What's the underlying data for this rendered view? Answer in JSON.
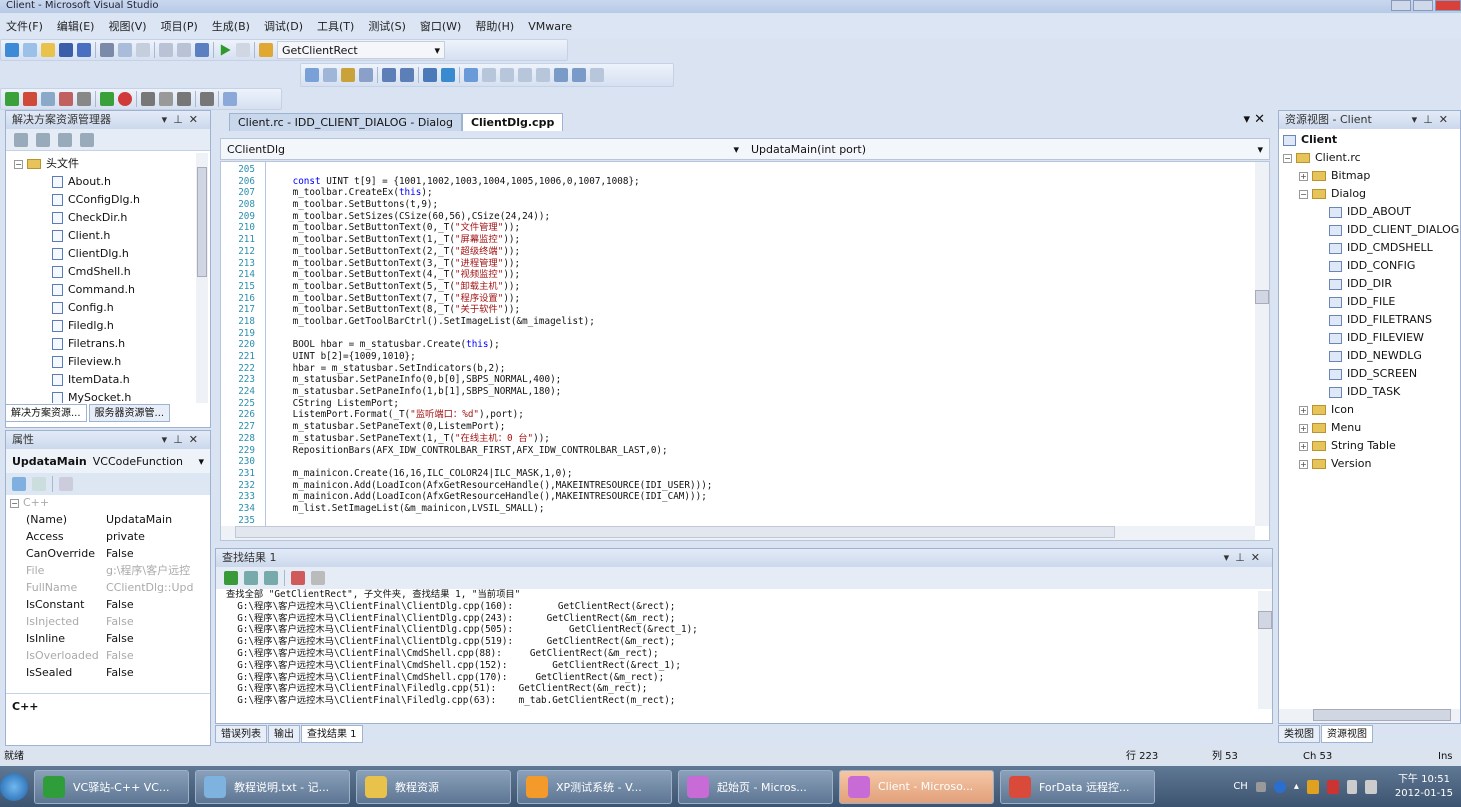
{
  "window": {
    "title": "Client - Microsoft Visual Studio"
  },
  "menu": [
    "文件(F)",
    "编辑(E)",
    "视图(V)",
    "项目(P)",
    "生成(B)",
    "调试(D)",
    "工具(T)",
    "测试(S)",
    "窗口(W)",
    "帮助(H)",
    "VMware"
  ],
  "toolbar": {
    "find_combo_value": "GetClientRect"
  },
  "solution_explorer": {
    "title": "解决方案资源管理器",
    "folder": "头文件",
    "files": [
      "About.h",
      "CConfigDlg.h",
      "CheckDir.h",
      "Client.h",
      "ClientDlg.h",
      "CmdShell.h",
      "Command.h",
      "Config.h",
      "Filedlg.h",
      "Filetrans.h",
      "Fileview.h",
      "ItemData.h",
      "MySocket.h"
    ],
    "tabs": [
      "解决方案资源...",
      "服务器资源管..."
    ]
  },
  "properties": {
    "title": "属性",
    "object_name": "UpdataMain",
    "object_type": "VCCodeFunction",
    "category": "C++",
    "rows": [
      {
        "k": "(Name)",
        "v": "UpdataMain",
        "dim": false
      },
      {
        "k": "Access",
        "v": "private",
        "dim": false
      },
      {
        "k": "CanOverride",
        "v": "False",
        "dim": false
      },
      {
        "k": "File",
        "v": "g:\\程序\\客户远控",
        "dim": true
      },
      {
        "k": "FullName",
        "v": "CClientDlg::Upd",
        "dim": true
      },
      {
        "k": "IsConstant",
        "v": "False",
        "dim": false
      },
      {
        "k": "IsInjected",
        "v": "False",
        "dim": true
      },
      {
        "k": "IsInline",
        "v": "False",
        "dim": false
      },
      {
        "k": "IsOverloaded",
        "v": "False",
        "dim": true
      },
      {
        "k": "IsSealed",
        "v": "False",
        "dim": false
      }
    ],
    "description": "C++"
  },
  "editor": {
    "tabs": [
      {
        "label": "Client.rc - IDD_CLIENT_DIALOG - Dialog",
        "active": false
      },
      {
        "label": "ClientDlg.cpp",
        "active": true
      }
    ],
    "class_combo": "CClientDlg",
    "member_combo": "UpdataMain(int port)",
    "first_line": 205,
    "lines": [
      "",
      "const UINT t[9] = {1001,1002,1003,1004,1005,1006,0,1007,1008};",
      "m_toolbar.CreateEx(this);",
      "m_toolbar.SetButtons(t,9);",
      "m_toolbar.SetSizes(CSize(60,56),CSize(24,24));",
      "m_toolbar.SetButtonText(0,_T(\"文件管理\"));",
      "m_toolbar.SetButtonText(1,_T(\"屏幕监控\"));",
      "m_toolbar.SetButtonText(2,_T(\"超级终端\"));",
      "m_toolbar.SetButtonText(3,_T(\"进程管理\"));",
      "m_toolbar.SetButtonText(4,_T(\"视频监控\"));",
      "m_toolbar.SetButtonText(5,_T(\"卸载主机\"));",
      "m_toolbar.SetButtonText(7,_T(\"程序设置\"));",
      "m_toolbar.SetButtonText(8,_T(\"关于软件\"));",
      "m_toolbar.GetToolBarCtrl().SetImageList(&m_imagelist);",
      "",
      "BOOL hbar = m_statusbar.Create(this);",
      "UINT b[2]={1009,1010};",
      "hbar = m_statusbar.SetIndicators(b,2);",
      "m_statusbar.SetPaneInfo(0,b[0],SBPS_NORMAL,400);",
      "m_statusbar.SetPaneInfo(1,b[1],SBPS_NORMAL,180);",
      "CString ListemPort;",
      "ListemPort.Format(_T(\"监听端口：%d\"),port);",
      "m_statusbar.SetPaneText(0,ListemPort);",
      "m_statusbar.SetPaneText(1,_T(\"在线主机：0 台\"));",
      "RepositionBars(AFX_IDW_CONTROLBAR_FIRST,AFX_IDW_CONTROLBAR_LAST,0);",
      "",
      "m_mainicon.Create(16,16,ILC_COLOR24|ILC_MASK,1,0);",
      "m_mainicon.Add(LoadIcon(AfxGetResourceHandle(),MAKEINTRESOURCE(IDI_USER)));",
      "m_mainicon.Add(LoadIcon(AfxGetResourceHandle(),MAKEINTRESOURCE(IDI_CAM)));",
      "m_list.SetImageList(&m_mainicon,LVSIL_SMALL);",
      ""
    ]
  },
  "find_results": {
    "title": "查找结果 1",
    "lines": [
      "查找全部 \"GetClientRect\", 子文件夹, 查找结果 1, \"当前项目\"",
      "  G:\\程序\\客户远控木马\\ClientFinal\\ClientDlg.cpp(160):        GetClientRect(&rect);",
      "  G:\\程序\\客户远控木马\\ClientFinal\\ClientDlg.cpp(243):      GetClientRect(&m_rect);",
      "  G:\\程序\\客户远控木马\\ClientFinal\\ClientDlg.cpp(505):          GetClientRect(&rect_1);",
      "  G:\\程序\\客户远控木马\\ClientFinal\\ClientDlg.cpp(519):      GetClientRect(&m_rect);",
      "  G:\\程序\\客户远控木马\\ClientFinal\\CmdShell.cpp(88):     GetClientRect(&m_rect);",
      "  G:\\程序\\客户远控木马\\ClientFinal\\CmdShell.cpp(152):        GetClientRect(&rect_1);",
      "  G:\\程序\\客户远控木马\\ClientFinal\\CmdShell.cpp(170):     GetClientRect(&m_rect);",
      "  G:\\程序\\客户远控木马\\ClientFinal\\Filedlg.cpp(51):    GetClientRect(&m_rect);",
      "  G:\\程序\\客户远控木马\\ClientFinal\\Filedlg.cpp(63):    m_tab.GetClientRect(m_rect);"
    ],
    "tabs": [
      "错误列表",
      "输出",
      "查找结果 1"
    ]
  },
  "resource_view": {
    "title": "资源视图 - Client",
    "root": "Client",
    "rc": "Client.rc",
    "folders_before": [
      "Bitmap"
    ],
    "dialog_folder": "Dialog",
    "dialogs": [
      "IDD_ABOUT",
      "IDD_CLIENT_DIALOG",
      "IDD_CMDSHELL",
      "IDD_CONFIG",
      "IDD_DIR",
      "IDD_FILE",
      "IDD_FILETRANS",
      "IDD_FILEVIEW",
      "IDD_NEWDLG",
      "IDD_SCREEN",
      "IDD_TASK"
    ],
    "folders_after": [
      "Icon",
      "Menu",
      "String Table",
      "Version"
    ],
    "tabs": [
      "类视图",
      "资源视图"
    ]
  },
  "statusbar": {
    "left": "就绪",
    "line": "行 223",
    "col": "列 53",
    "ch": "Ch 53",
    "mode": "Ins"
  },
  "taskbar": {
    "items": [
      {
        "label": "VC驿站-C++ VC...",
        "color": "#2f9e3a"
      },
      {
        "label": "教程说明.txt - 记...",
        "color": "#7fb3df"
      },
      {
        "label": "教程资源",
        "color": "#e8c24a"
      },
      {
        "label": "XP测试系统 - V...",
        "color": "#f39a2b"
      },
      {
        "label": "起始页 - Micros...",
        "color": "#c86bd6"
      },
      {
        "label": "Client - Microso...",
        "color": "#c86bd6",
        "active": true
      },
      {
        "label": "ForData 远程控...",
        "color": "#d94a3a"
      }
    ],
    "tray_lang": "CH",
    "time": "下午 10:51",
    "date": "2012-01-15"
  }
}
